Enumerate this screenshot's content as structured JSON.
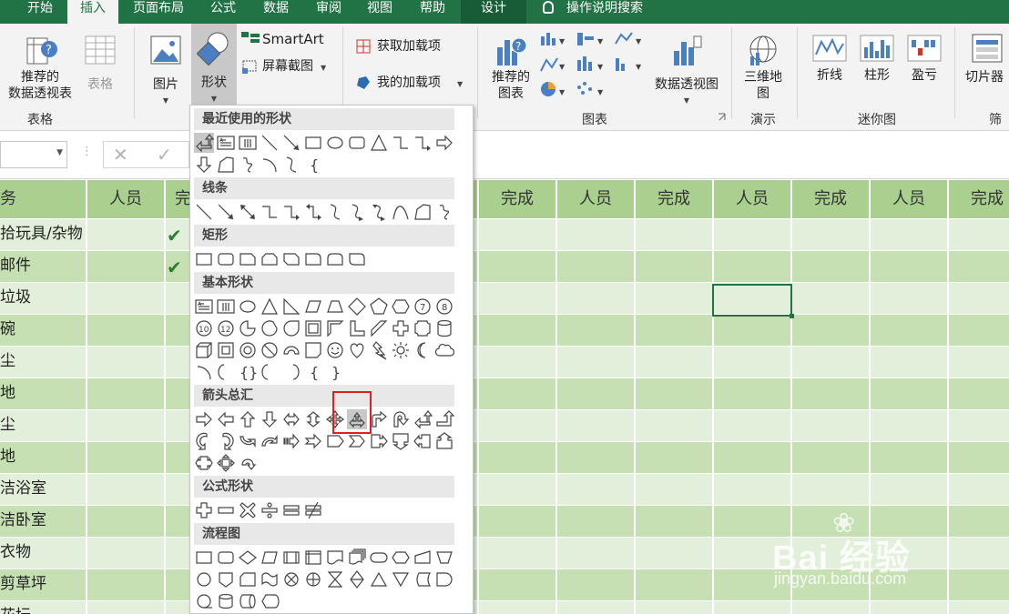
{
  "tabs": [
    "开始",
    "插入",
    "页面布局",
    "公式",
    "数据",
    "审阅",
    "视图",
    "帮助",
    "设计"
  ],
  "tell_me": "操作说明搜索",
  "ribbon": {
    "recommended_pivot": "推荐的\n数据透视表",
    "table": "表格",
    "picture": "图片",
    "shapes": "形状",
    "smartart": "SmartArt",
    "screenshot": "屏幕截图",
    "get_addins": "获取加载项",
    "my_addins": "我的加载项",
    "recommended_charts": "推荐的\n图表",
    "pivot_chart": "数据透视图",
    "map_3d": "三维地\n图",
    "line": "折线",
    "column": "柱形",
    "winloss": "盈亏",
    "slicer": "切片器",
    "groups": {
      "tables": "表格",
      "charts": "图表",
      "tours": "演示",
      "sparklines": "迷你图",
      "filters": "筛"
    }
  },
  "formula_bar": {
    "cancel": "✕",
    "enter": "✓"
  },
  "sheet": {
    "headers": [
      "务",
      "人员",
      "完",
      "完成",
      "人员",
      "完成",
      "人员",
      "完成",
      "人员",
      "完成"
    ],
    "tasks": [
      "拾玩具/杂物",
      "邮件",
      "垃圾",
      "碗",
      "尘",
      "地",
      "尘",
      "地",
      "洁浴室",
      "洁卧室",
      "衣物",
      "剪草坪",
      "花坛"
    ],
    "checks": [
      "✔",
      "✔"
    ]
  },
  "shapes_menu": {
    "sections": [
      "最近使用的形状",
      "线条",
      "矩形",
      "基本形状",
      "箭头总汇",
      "公式形状",
      "流程图"
    ],
    "text_glyphs": [
      "{",
      "{}",
      "{",
      "}",
      "10",
      "12",
      "7",
      "8"
    ]
  },
  "watermark": {
    "brand": "Bai   经验",
    "url": "jingyan.baidu.com"
  },
  "colors": {
    "excel_green": "#217346",
    "header_green": "#a9d08e",
    "row_light": "#e2efda",
    "row_dark": "#c6e0b4",
    "highlight_red": "#e02020"
  }
}
